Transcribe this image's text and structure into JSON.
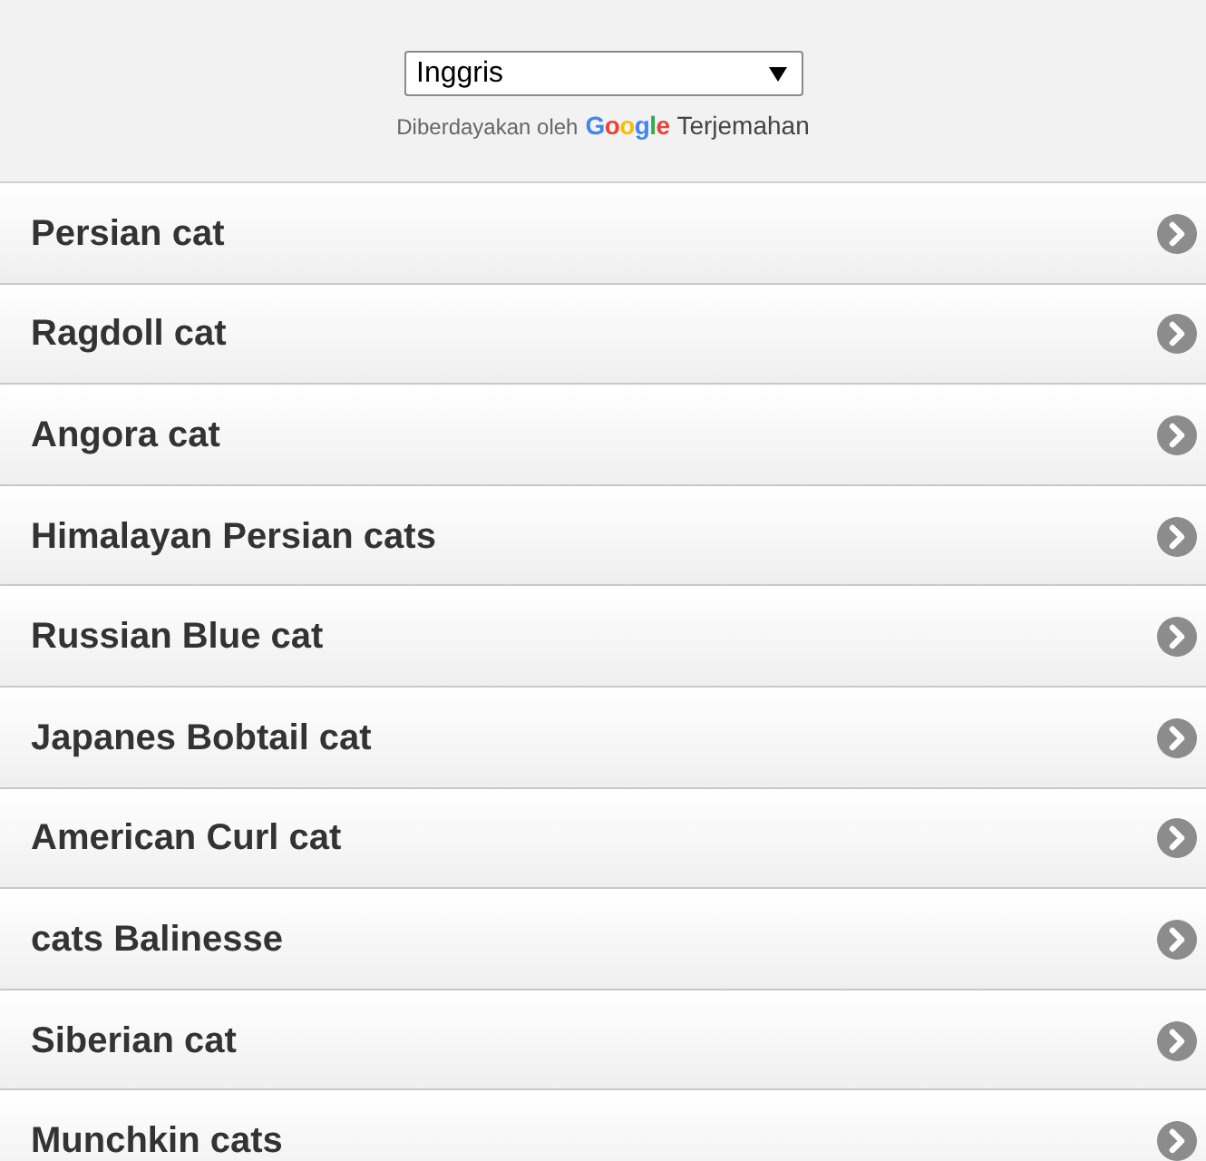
{
  "translate": {
    "language_select": {
      "value": "Inggris"
    },
    "powered_by": "Diberdayakan oleh",
    "logo": "Google",
    "service": "Terjemahan"
  },
  "list": {
    "items": [
      {
        "label": "Persian cat"
      },
      {
        "label": "Ragdoll cat"
      },
      {
        "label": "Angora cat"
      },
      {
        "label": "Himalayan Persian cats"
      },
      {
        "label": "Russian Blue cat"
      },
      {
        "label": "Japanes Bobtail cat"
      },
      {
        "label": "American Curl cat"
      },
      {
        "label": "cats Balinesse"
      },
      {
        "label": "Siberian cat"
      },
      {
        "label": "Munchkin cats"
      }
    ]
  }
}
